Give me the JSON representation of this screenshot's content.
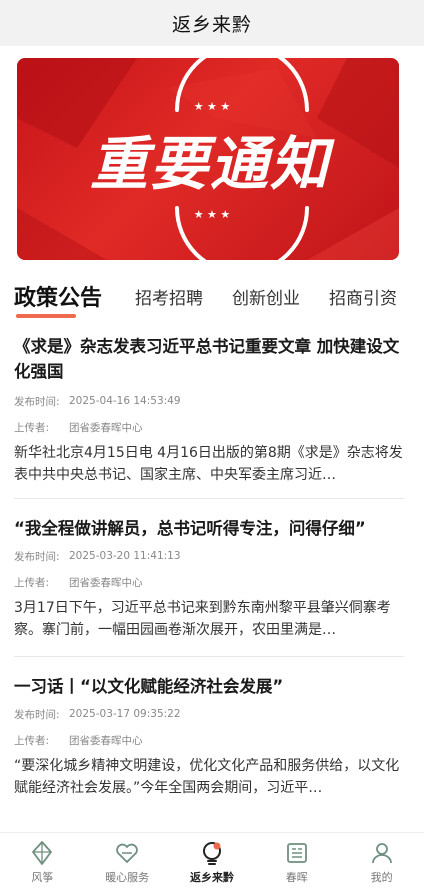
{
  "header": {
    "title": "返乡来黔"
  },
  "banner": {
    "headline": "重要通知",
    "stars": "★ ★ ★",
    "colors": {
      "background": "#d41c1f",
      "text": "#ffffff"
    }
  },
  "tabs": [
    {
      "label": "政策公告",
      "active": true
    },
    {
      "label": "招考招聘"
    },
    {
      "label": "创新创业"
    },
    {
      "label": "招商引资"
    }
  ],
  "meta_labels": {
    "published": "发布时间:",
    "uploader": "上传者:"
  },
  "news": [
    {
      "title": "《求是》杂志发表习近平总书记重要文章 加快建设文化强国",
      "published": "2025-04-16 14:53:49",
      "uploader": "团省委春晖中心",
      "summary": "新华社北京4月15日电  4月16日出版的第8期《求是》杂志将发表中共中央总书记、国家主席、中央军委主席习近…"
    },
    {
      "title": "“我全程做讲解员，总书记听得专注，问得仔细”",
      "published": "2025-03-20 11:41:13",
      "uploader": "团省委春晖中心",
      "summary": "3月17日下午，习近平总书记来到黔东南州黎平县肇兴侗寨考察。寨门前，一幅田园画卷渐次展开，农田里满是…"
    },
    {
      "title": "一习话丨“以文化赋能经济社会发展”",
      "published": "2025-03-17 09:35:22",
      "uploader": "团省委春晖中心",
      "summary": "“要深化城乡精神文明建设，优化文化产品和服务供给，以文化赋能经济社会发展。”今年全国两会期间，习近平…"
    }
  ],
  "tabbar": [
    {
      "label": "风筝",
      "icon": "kite-icon"
    },
    {
      "label": "暖心服务",
      "icon": "heart-service-icon"
    },
    {
      "label": "返乡来黔",
      "icon": "lightbulb-icon",
      "active": true
    },
    {
      "label": "春晖",
      "icon": "newspaper-icon"
    },
    {
      "label": "我的",
      "icon": "user-icon"
    }
  ],
  "colors": {
    "accent": "#ef6a4c",
    "icon_green": "#6f8f7f"
  }
}
